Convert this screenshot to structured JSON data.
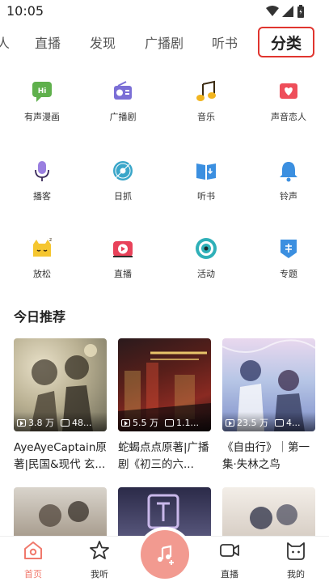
{
  "status_bar": {
    "time": "10:05"
  },
  "top_tabs": {
    "items": [
      "人",
      "直播",
      "发现",
      "广播剧",
      "听书"
    ],
    "active": "分类"
  },
  "categories": [
    {
      "label": "有声漫画",
      "icon": "comic-hi-icon",
      "color": "#5fb04c"
    },
    {
      "label": "广播剧",
      "icon": "radio-icon",
      "color": "#7b6fd6"
    },
    {
      "label": "音乐",
      "icon": "music-note-icon",
      "color": "#f2b51f"
    },
    {
      "label": "声音恋人",
      "icon": "heart-envelope-icon",
      "color": "#ee4e5a"
    },
    {
      "label": "播客",
      "icon": "microphone-icon",
      "color": "#9a7fe0"
    },
    {
      "label": "日抓",
      "icon": "disc-icon",
      "color": "#3aa6c9"
    },
    {
      "label": "听书",
      "icon": "book-icon",
      "color": "#3b8fe0"
    },
    {
      "label": "铃声",
      "icon": "bell-icon",
      "color": "#3b8fe0"
    },
    {
      "label": "放松",
      "icon": "sleepy-cat-icon",
      "color": "#f5c630"
    },
    {
      "label": "直播",
      "icon": "live-tv-icon",
      "color": "#e8425a"
    },
    {
      "label": "活动",
      "icon": "target-icon",
      "color": "#2fb0b8"
    },
    {
      "label": "专题",
      "icon": "special-shield-icon",
      "color": "#3b8fe0"
    }
  ],
  "section": {
    "title": "今日推荐"
  },
  "cards": [
    {
      "plays": "3.8 万",
      "episodes": "48...",
      "title": "AyeAyeCaptain原著|民国&现代 玄...",
      "palette": [
        "#b9b092",
        "#6e6b58",
        "#e8e0c8"
      ]
    },
    {
      "plays": "5.5 万",
      "episodes": "1.1...",
      "title": "蛇蝎点点原著|广播剧《初三的六...",
      "palette": [
        "#2a1a1c",
        "#8a2a22",
        "#d9b35a"
      ]
    },
    {
      "plays": "23.5 万",
      "episodes": "4...",
      "title": "《自由行》｜第一集·失林之鸟",
      "palette": [
        "#b7c6e6",
        "#7f8fc9",
        "#e9d8ee"
      ]
    }
  ],
  "nav": {
    "items": [
      {
        "label": "首页",
        "icon": "home-icon"
      },
      {
        "label": "我听",
        "icon": "star-icon"
      },
      {
        "label": "直播",
        "icon": "video-camera-icon"
      },
      {
        "label": "我的",
        "icon": "cat-face-icon"
      }
    ],
    "center_icon": "music-plus-icon",
    "accent": "#f0796c"
  }
}
